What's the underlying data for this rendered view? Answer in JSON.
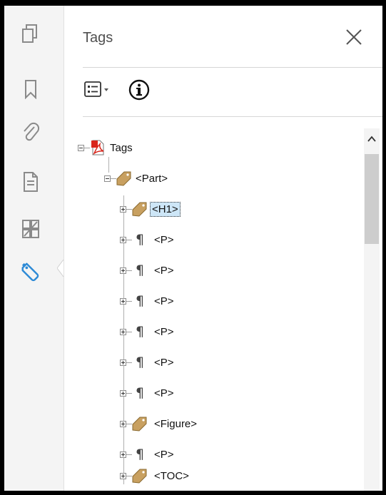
{
  "rail": {
    "icons": [
      "pages-icon",
      "bookmark-icon",
      "attachment-icon",
      "document-icon",
      "compare-icon",
      "tags-icon"
    ],
    "active": "tags-icon",
    "active_color": "#2d8ad6"
  },
  "panel": {
    "title": "Tags",
    "close_label": "×"
  },
  "tree": {
    "root": {
      "label": "Tags",
      "icon": "pdf-icon",
      "expanded": true
    },
    "part": {
      "label": "<Part>",
      "icon": "tag-icon",
      "expanded": true
    },
    "children": [
      {
        "label": "<H1>",
        "icon": "tag-icon",
        "selected": true
      },
      {
        "label": "<P>",
        "icon": "paragraph-icon"
      },
      {
        "label": "<P>",
        "icon": "paragraph-icon"
      },
      {
        "label": "<P>",
        "icon": "paragraph-icon"
      },
      {
        "label": "<P>",
        "icon": "paragraph-icon"
      },
      {
        "label": "<P>",
        "icon": "paragraph-icon"
      },
      {
        "label": "<P>",
        "icon": "paragraph-icon"
      },
      {
        "label": "<Figure>",
        "icon": "tag-icon"
      },
      {
        "label": "<P>",
        "icon": "paragraph-icon"
      },
      {
        "label": "<TOC>",
        "icon": "tag-icon"
      }
    ]
  },
  "colors": {
    "selection": "#cde6f7",
    "tag_fill": "#c8a060",
    "pdf_red": "#d9261c"
  }
}
